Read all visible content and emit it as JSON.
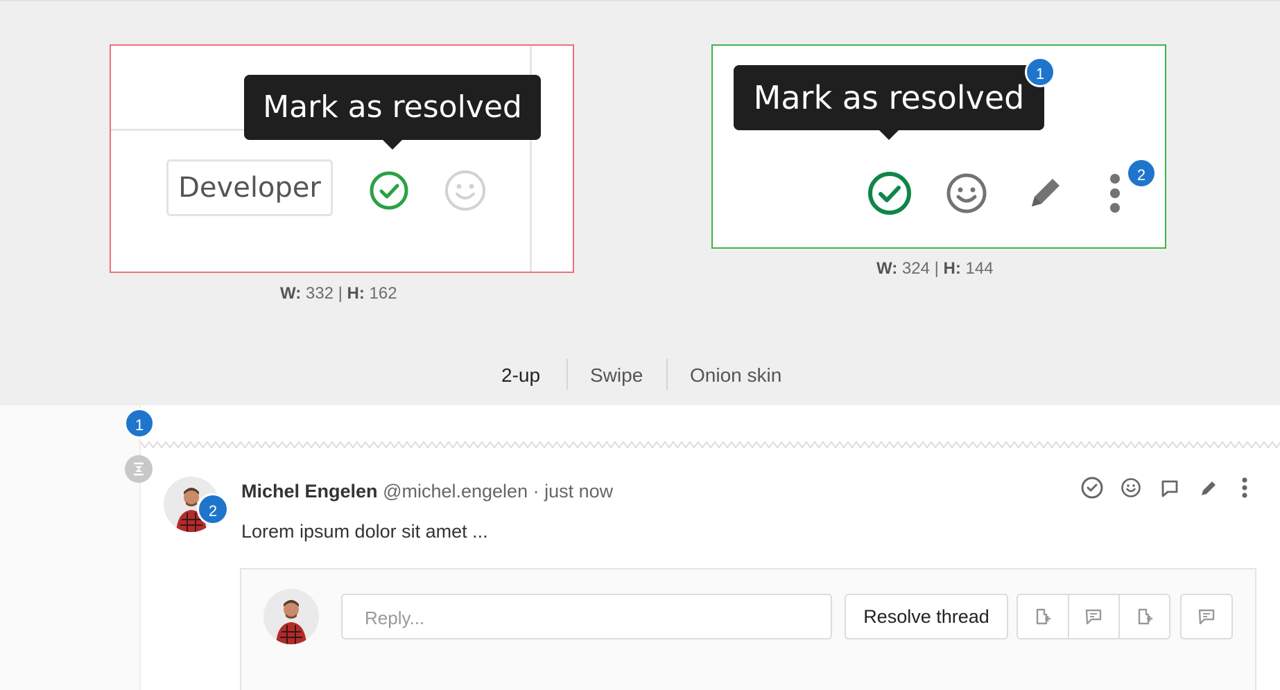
{
  "diff_view": {
    "old_image": {
      "tooltip": "Mark as resolved",
      "role_badge": "Developer",
      "dimensions": {
        "w_label": "W:",
        "w_value": "332",
        "sep": "|",
        "h_label": "H:",
        "h_value": "162"
      }
    },
    "new_image": {
      "tooltip": "Mark as resolved",
      "badges": [
        "1",
        "2"
      ],
      "dimensions": {
        "w_label": "W:",
        "w_value": "324",
        "sep": "|",
        "h_label": "H:",
        "h_value": "144"
      }
    },
    "modes": [
      "2-up",
      "Swipe",
      "Onion skin"
    ],
    "active_mode": "2-up"
  },
  "thread": {
    "marker_badge": "1",
    "avatar_badge": "2",
    "author": "Michel Engelen",
    "handle": "@michel.engelen",
    "time": "· just now",
    "body": "Lorem ipsum dolor sit amet ...",
    "reply_placeholder": "Reply...",
    "resolve_label": "Resolve thread"
  },
  "colors": {
    "old_border": "#ef6f7d",
    "new_border": "#3bb44a",
    "badge": "#1f75cb",
    "resolved_green": "#108548",
    "tooltip_bg": "#1f1f1f"
  }
}
